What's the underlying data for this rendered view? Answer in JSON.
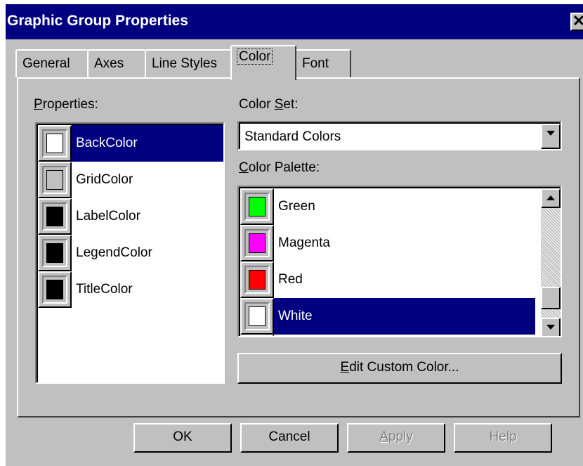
{
  "window": {
    "title": "Graphic Group Properties",
    "close_label": "✕"
  },
  "tabs": [
    {
      "label": "General"
    },
    {
      "label": "Axes"
    },
    {
      "label": "Line Styles"
    },
    {
      "label": "Color",
      "active": true
    },
    {
      "label": "Font"
    }
  ],
  "properties": {
    "label_first": "P",
    "label_rest": "roperties:",
    "items": [
      {
        "label": "BackColor",
        "color": "#ffffff",
        "selected": true
      },
      {
        "label": "GridColor",
        "color": "#c0c0c0"
      },
      {
        "label": "LabelColor",
        "color": "#000000"
      },
      {
        "label": "LegendColor",
        "color": "#000000"
      },
      {
        "label": "TitleColor",
        "color": "#000000"
      }
    ]
  },
  "color_set": {
    "label_pre": "Color ",
    "label_u": "S",
    "label_post": "et:",
    "value": "Standard Colors"
  },
  "color_palette": {
    "label_u": "C",
    "label_rest": "olor Palette:",
    "items": [
      {
        "label": "Green",
        "color": "#00ff00"
      },
      {
        "label": "Magenta",
        "color": "#ff00ff"
      },
      {
        "label": "Red",
        "color": "#ff0000"
      },
      {
        "label": "White",
        "color": "#ffffff",
        "selected": true
      }
    ]
  },
  "edit_custom": {
    "label_u": "E",
    "label_rest": "dit Custom Color..."
  },
  "buttons": {
    "ok": "OK",
    "cancel": "Cancel",
    "apply_u": "A",
    "apply_rest": "pply",
    "help": "Help"
  },
  "colors": {
    "titlebar": "#000080",
    "face": "#c0c0c0",
    "selection": "#000080"
  }
}
